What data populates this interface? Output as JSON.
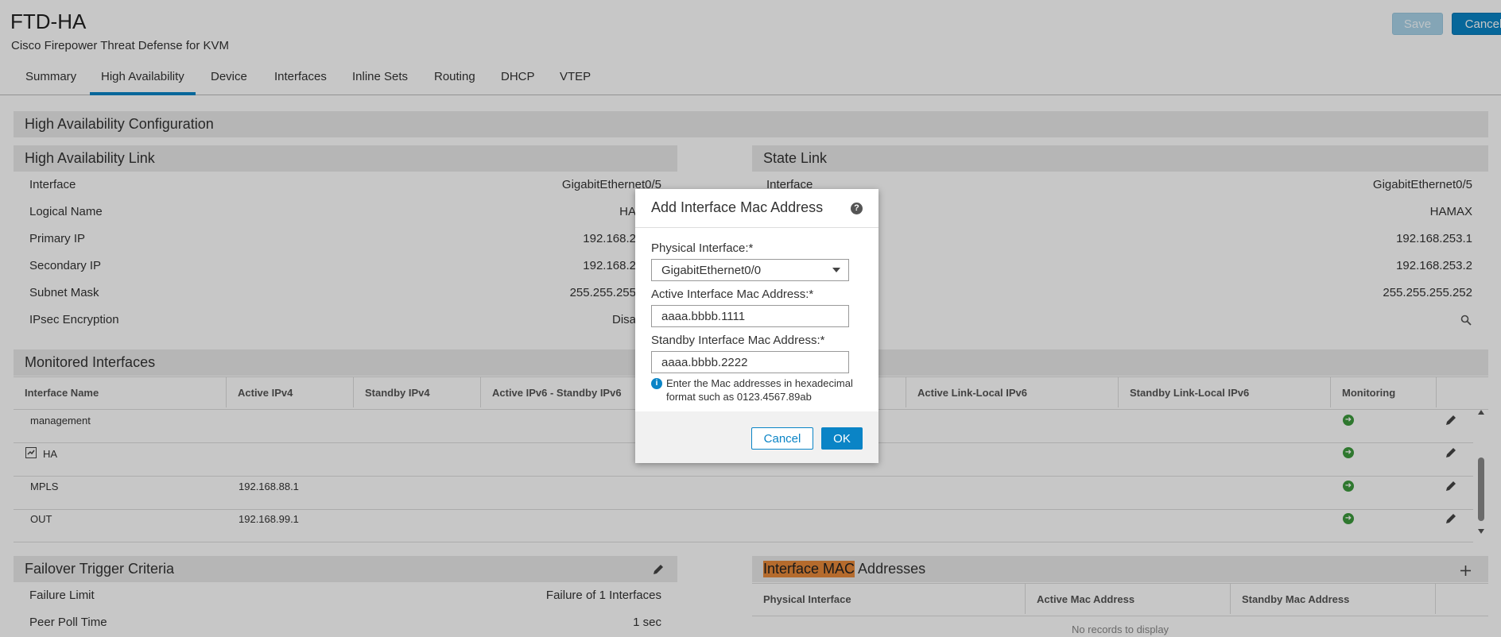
{
  "header": {
    "title": "FTD-HA",
    "subtitle": "Cisco Firepower Threat Defense for KVM",
    "save_label": "Save",
    "cancel_label": "Cancel"
  },
  "tabs": [
    {
      "label": "Summary"
    },
    {
      "label": "High Availability",
      "active": true
    },
    {
      "label": "Device"
    },
    {
      "label": "Interfaces"
    },
    {
      "label": "Inline Sets"
    },
    {
      "label": "Routing"
    },
    {
      "label": "DHCP"
    },
    {
      "label": "VTEP"
    }
  ],
  "ha_config": {
    "title": "High Availability Configuration"
  },
  "ha_link": {
    "title": "High Availability Link",
    "rows": [
      {
        "label": "Interface",
        "value": "GigabitEthernet0/5"
      },
      {
        "label": "Logical Name",
        "value": "HA"
      },
      {
        "label": "Primary IP",
        "value": "192.168.2"
      },
      {
        "label": "Secondary IP",
        "value": "192.168.2"
      },
      {
        "label": "Subnet Mask",
        "value": "255.255.255"
      },
      {
        "label": "IPsec Encryption",
        "value": "Disa"
      }
    ]
  },
  "state_link": {
    "title": "State Link",
    "rows": [
      {
        "label": "Interface",
        "value": "GigabitEthernet0/5"
      },
      {
        "label": "",
        "value": "HAMAX"
      },
      {
        "label": "",
        "value": "192.168.253.1"
      },
      {
        "label": "",
        "value": "192.168.253.2"
      },
      {
        "label": "",
        "value": "255.255.255.252"
      }
    ]
  },
  "monitored": {
    "title": "Monitored Interfaces",
    "columns": [
      "Interface Name",
      "Active IPv4",
      "Standby IPv4",
      "Active IPv6 - Standby IPv6",
      "",
      "Active Link-Local IPv6",
      "Standby Link-Local IPv6",
      "Monitoring"
    ],
    "rows": [
      {
        "name": "management",
        "active_ipv4": ""
      },
      {
        "name": "HA",
        "active_ipv4": ""
      },
      {
        "name": "MPLS",
        "active_ipv4": "192.168.88.1"
      },
      {
        "name": "OUT",
        "active_ipv4": "192.168.99.1"
      }
    ]
  },
  "failover": {
    "title": "Failover Trigger Criteria",
    "rows": [
      {
        "label": "Failure Limit",
        "value": "Failure of 1 Interfaces"
      },
      {
        "label": "Peer Poll Time",
        "value": "1 sec"
      }
    ]
  },
  "mac_section": {
    "title_highlight": "Interface MAC",
    "title_rest": " Addresses",
    "columns": [
      "Physical Interface",
      "Active Mac Address",
      "Standby Mac Address"
    ],
    "empty": "No records to display"
  },
  "modal": {
    "title": "Add Interface Mac Address",
    "physical_label": "Physical Interface:*",
    "physical_value": "GigabitEthernet0/0",
    "active_label": "Active Interface Mac Address:*",
    "active_value": "aaaa.bbbb.1111",
    "standby_label": "Standby Interface Mac Address:*",
    "standby_value": "aaaa.bbbb.2222",
    "hint": "Enter the Mac addresses in hexadecimal format such as 0123.4567.89ab",
    "cancel_label": "Cancel",
    "ok_label": "OK"
  },
  "colors": {
    "accent": "#0a84c6",
    "monitor_ok": "#3d9a3d",
    "highlight": "#e8893a"
  }
}
